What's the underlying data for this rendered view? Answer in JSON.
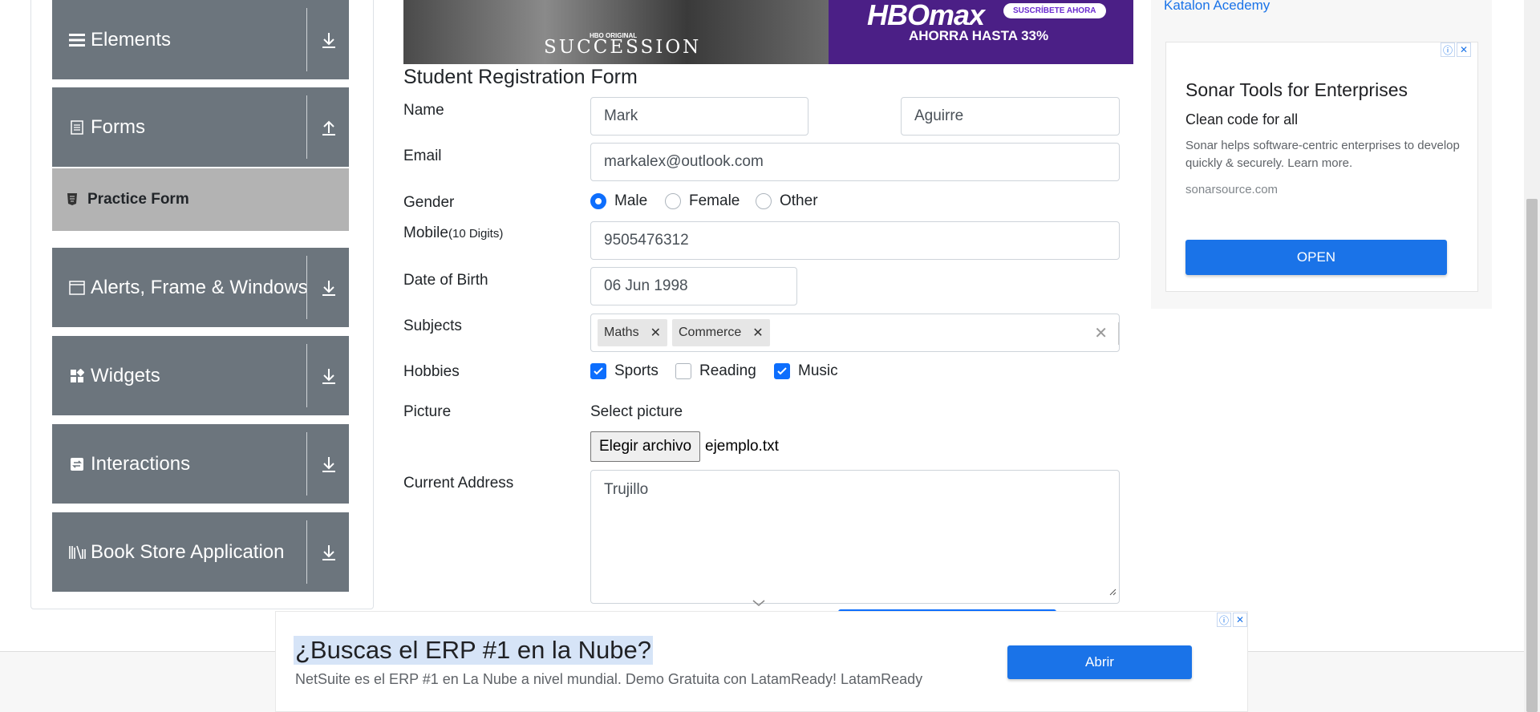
{
  "sidebar": {
    "groups": [
      {
        "label": "Elements",
        "icon": "list-icon",
        "arrow": "download-arrow-icon"
      },
      {
        "label": "Forms",
        "icon": "document-icon",
        "arrow": "upload-arrow-icon"
      },
      {
        "label": "Alerts, Frame & Windows",
        "icon": "window-icon",
        "arrow": "download-arrow-icon"
      },
      {
        "label": "Widgets",
        "icon": "widgets-icon",
        "arrow": "download-arrow-icon"
      },
      {
        "label": "Interactions",
        "icon": "interactions-icon",
        "arrow": "download-arrow-icon"
      },
      {
        "label": "Book Store Application",
        "icon": "books-icon",
        "arrow": "download-arrow-icon"
      }
    ],
    "active_item": {
      "label": "Practice Form",
      "icon": "html5-icon"
    }
  },
  "banner": {
    "show_badge": "HBO ORIGINAL",
    "show_title": "SUCCESSION",
    "brand": "HBOmax",
    "cta": "SUSCRÍBETE AHORA",
    "offer": "AHORRA HASTA 33%"
  },
  "form": {
    "title": "Student Registration Form",
    "labels": {
      "name": "Name",
      "email": "Email",
      "gender": "Gender",
      "mobile": "Mobile",
      "mobile_hint": "(10 Digits)",
      "dob": "Date of Birth",
      "subjects": "Subjects",
      "hobbies": "Hobbies",
      "picture": "Picture",
      "address": "Current Address"
    },
    "first_name": "Mark",
    "last_name": "Aguirre",
    "email": "markalex@outlook.com",
    "gender_options": [
      {
        "label": "Male",
        "checked": true
      },
      {
        "label": "Female",
        "checked": false
      },
      {
        "label": "Other",
        "checked": false
      }
    ],
    "mobile": "9505476312",
    "dob": "06 Jun 1998",
    "subjects": [
      "Maths",
      "Commerce"
    ],
    "hobbies": [
      {
        "label": "Sports",
        "checked": true
      },
      {
        "label": "Reading",
        "checked": false
      },
      {
        "label": "Music",
        "checked": true
      }
    ],
    "picture_label": "Select picture",
    "file_button": "Elegir archivo",
    "file_name": "ejemplo.txt",
    "address": "Trujillo"
  },
  "ad_right": {
    "broken_image_alt": "Katalon Acedemy",
    "title": "Sonar Tools for Enterprises",
    "subtitle": "Clean code for all",
    "description": "Sonar helps software-centric enterprises to develop quickly & securely. Learn more.",
    "url": "sonarsource.com",
    "button": "OPEN"
  },
  "ad_bottom": {
    "headline": "¿Buscas el ERP #1 en la Nube?",
    "description": "NetSuite es el ERP #1 en La Nube a nivel mundial. Demo Gratuita con LatamReady! LatamReady",
    "button": "Abrir"
  },
  "colors": {
    "sidebar_bg": "#6c757d",
    "active_item_bg": "#b3b3b3",
    "primary": "#0d6efd",
    "ad_button": "#1a73e8"
  }
}
